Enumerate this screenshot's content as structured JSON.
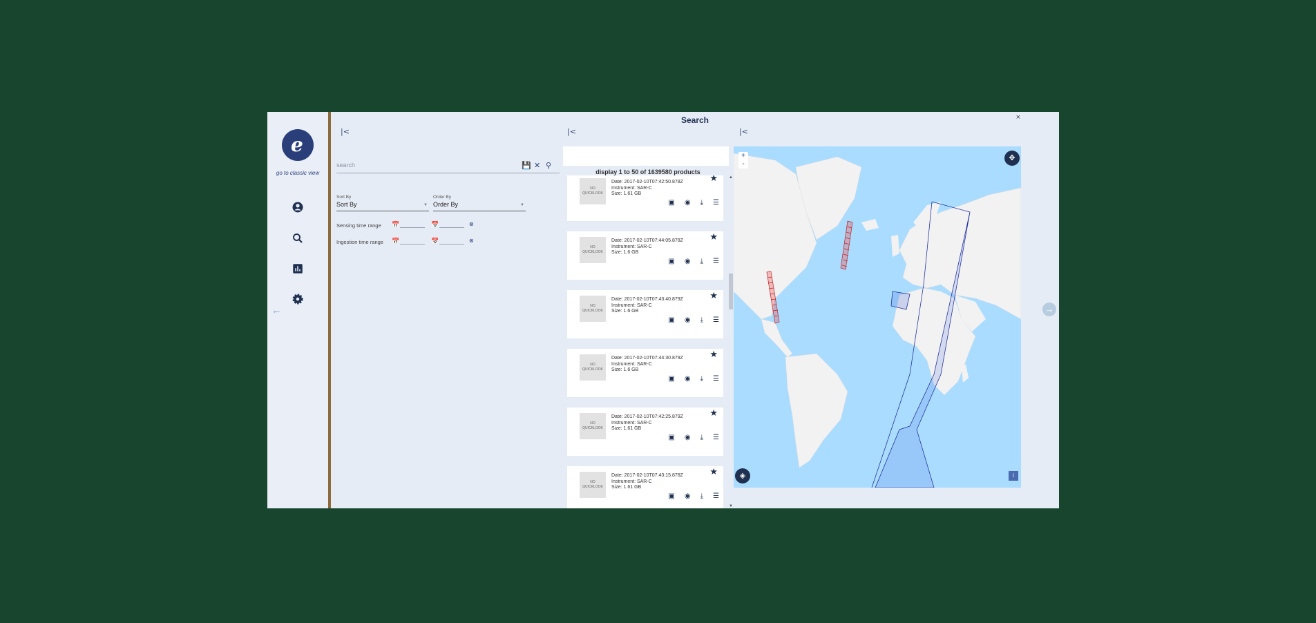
{
  "window": {
    "title": "Search",
    "close": "×"
  },
  "sidebar": {
    "logo_letter": "e",
    "classic_link": "go to classic view",
    "back_arrow": "←",
    "items": [
      {
        "icon": "account-circle-icon"
      },
      {
        "icon": "search-icon"
      },
      {
        "icon": "chart-icon"
      },
      {
        "icon": "settings-icon"
      }
    ]
  },
  "filters": {
    "collapse": "|<",
    "search_placeholder": "search",
    "sort_by_label": "Sort By",
    "sort_by_value": "Sort By",
    "order_by_label": "Order By",
    "order_by_value": "Order By",
    "sensing_label": "Sensing time range",
    "ingestion_label": "Ingestion time range"
  },
  "results": {
    "collapse": "|<",
    "count_text": "display 1 to 50 of 1639580 products",
    "thumb_text": "NO QUICKLOOK",
    "items": [
      {
        "date": "Date: 2017-02-10T07:42:50.878Z",
        "instrument": "Instrument: SAR-C",
        "size": "Size: 1.61 GB"
      },
      {
        "date": "Date: 2017-02-10T07:44:05.878Z",
        "instrument": "Instrument: SAR-C",
        "size": "Size: 1.6 GB"
      },
      {
        "date": "Date: 2017-02-10T07:43:40.879Z",
        "instrument": "Instrument: SAR-C",
        "size": "Size: 1.6 GB"
      },
      {
        "date": "Date: 2017-02-10T07:44:30.879Z",
        "instrument": "Instrument: SAR-C",
        "size": "Size: 1.6 GB"
      },
      {
        "date": "Date: 2017-02-10T07:42:25.879Z",
        "instrument": "Instrument: SAR-C",
        "size": "Size: 1.61 GB"
      },
      {
        "date": "Date: 2017-02-10T07:43:15.878Z",
        "instrument": "Instrument: SAR-C",
        "size": "Size: 1.61 GB"
      }
    ]
  },
  "map": {
    "collapse": "|<",
    "zoom_in": "+",
    "zoom_out": "-",
    "info": "i"
  },
  "colors": {
    "accent": "#1f3050",
    "footprint": "#d33333",
    "ocean": "#a9dcff",
    "land": "#f2f2f2"
  }
}
